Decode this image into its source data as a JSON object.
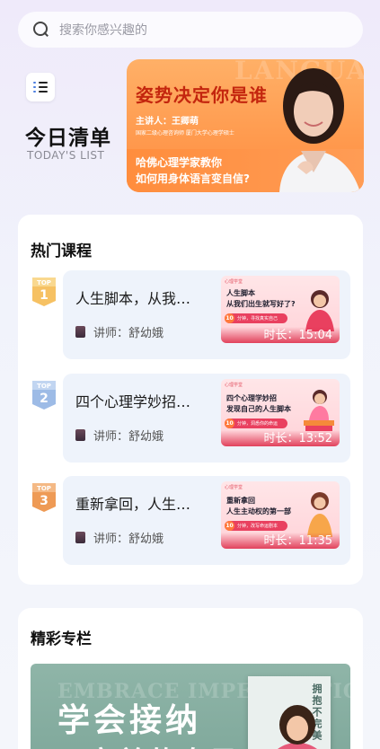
{
  "search": {
    "placeholder": "搜索你感兴趣的"
  },
  "today": {
    "title": "今日清单",
    "subtitle": "TODAY'S LIST"
  },
  "banner": {
    "watermark": "LANGUAGE",
    "title": "姿势决定你是谁",
    "speaker": "主讲人：王卿萌",
    "credential": "国家二级心理咨询师  厦门大学心理学硕士",
    "line1": "哈佛心理学家教你",
    "line2": "如何用身体语言变自信?"
  },
  "hot": {
    "heading": "热门课程",
    "courses": [
      {
        "rank_word": "TOP",
        "rank": "1",
        "title": "人生脚本，从我…",
        "tutor": "讲师：舒幼娥",
        "thumb_tag": "心理学堂",
        "thumb_line1": "人生脚本",
        "thumb_line2": "从我们出生就写好了?",
        "pill_num": "10",
        "pill_text": "分钟，寻找真实自己",
        "duration": "时长：15:04",
        "badge_color": "#f0b24a"
      },
      {
        "rank_word": "TOP",
        "rank": "2",
        "title": "四个心理学妙招…",
        "tutor": "讲师：舒幼娥",
        "thumb_tag": "心理学堂",
        "thumb_line1": "四个心理学妙招",
        "thumb_line2": "发现自己的人生脚本",
        "pill_num": "10",
        "pill_text": "分钟，洞悉你的命运",
        "duration": "时长：13:52",
        "badge_color": "#8fb0de"
      },
      {
        "rank_word": "TOP",
        "rank": "3",
        "title": "重新拿回，人生…",
        "tutor": "讲师：舒幼娥",
        "thumb_tag": "心理学堂",
        "thumb_line1": "重新拿回",
        "thumb_line2": "人生主动权的第一部",
        "pill_num": "10",
        "pill_text": "分钟，改写命运剧本",
        "duration": "时长：11:35",
        "badge_color": "#e9924a"
      }
    ]
  },
  "column": {
    "heading": "精彩专栏",
    "watermark": "EMBRACE IMPERFECTION",
    "big_text": "学会接纳",
    "big_text2": "不完美的自己",
    "book_title": "拥抱不完美"
  },
  "colors": {
    "accent_orange": "#ff9a4e",
    "banner_red": "#c4260e",
    "thumb_red": "#e9405f"
  }
}
